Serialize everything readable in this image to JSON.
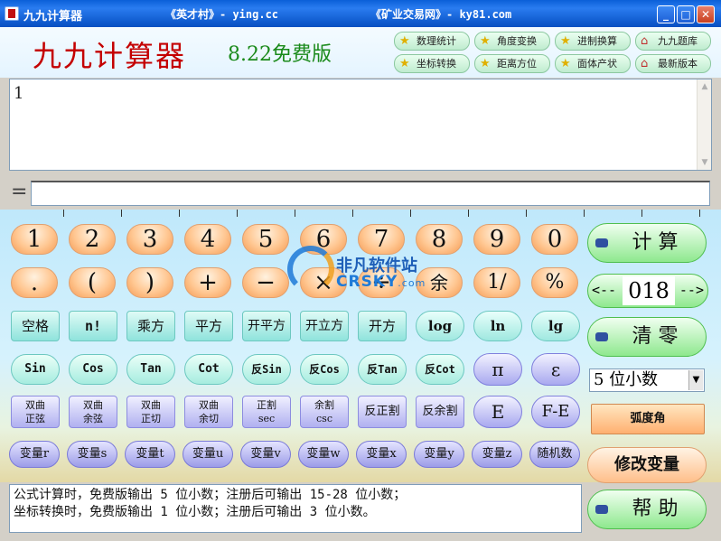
{
  "window": {
    "title": "九九计算器",
    "site1": "《英才村》- ying.cc",
    "site2": "《矿业交易网》- ky81.com"
  },
  "header": {
    "app_name": "九九计算器",
    "version": "8.22免费版",
    "tools": [
      {
        "label": "数理统计",
        "icon": "star-icon"
      },
      {
        "label": "角度变换",
        "icon": "star-icon"
      },
      {
        "label": "进制换算",
        "icon": "star-icon"
      },
      {
        "label": "九九题库",
        "icon": "house-icon"
      },
      {
        "label": "坐标转换",
        "icon": "star-icon"
      },
      {
        "label": "距离方位",
        "icon": "star-icon"
      },
      {
        "label": "面体产状",
        "icon": "star-icon"
      },
      {
        "label": "最新版本",
        "icon": "house-icon"
      }
    ]
  },
  "display": {
    "expression": "1",
    "equals": "=",
    "result": ""
  },
  "keys": {
    "digits": [
      "1",
      "2",
      "3",
      "4",
      "5",
      "6",
      "7",
      "8",
      "9",
      "0"
    ],
    "row2": [
      ".",
      "(",
      ")",
      "+",
      "−",
      "×",
      "÷",
      "余",
      "1/",
      "%"
    ],
    "row3": [
      "空格",
      "n!",
      "乘方",
      "平方",
      "开平方",
      "开立方",
      "开方",
      "log",
      "ln",
      "lg"
    ],
    "row4": [
      "Sin",
      "Cos",
      "Tan",
      "Cot",
      "反Sin",
      "反Cos",
      "反Tan",
      "反Cot",
      "π",
      "ε"
    ],
    "row5": [
      {
        "l1": "双曲",
        "l2": "正弦"
      },
      {
        "l1": "双曲",
        "l2": "余弦"
      },
      {
        "l1": "双曲",
        "l2": "正切"
      },
      {
        "l1": "双曲",
        "l2": "余切"
      },
      {
        "l1": "正割",
        "l2": "sec"
      },
      {
        "l1": "余割",
        "l2": "csc"
      },
      {
        "l1": "反正割",
        "l2": ""
      },
      {
        "l1": "反余割",
        "l2": ""
      },
      {
        "l1": "E",
        "l2": ""
      },
      {
        "l1": "F-E",
        "l2": ""
      }
    ],
    "row6": [
      "变量r",
      "变量s",
      "变量t",
      "变量u",
      "变量v",
      "变量w",
      "变量x",
      "变量y",
      "变量z",
      "随机数"
    ]
  },
  "side": {
    "calc_label": "计 算",
    "nav_left": "<--",
    "nav_right": "-->",
    "counter": "018",
    "clear_label": "清 零",
    "decimal_select": "5 位小数",
    "angle_mode": "弧度角",
    "edit_vars": "修改变量",
    "help_label": "帮 助"
  },
  "watermark": {
    "cn": "非凡软件站",
    "en": "CRSKY",
    "domain": ".com"
  },
  "status": {
    "line1": "公式计算时，免费版输出 5 位小数；注册后可输出 15-28 位小数；",
    "line2": "坐标转换时，免费版输出 1 位小数；注册后可输出 3 位小数。"
  }
}
